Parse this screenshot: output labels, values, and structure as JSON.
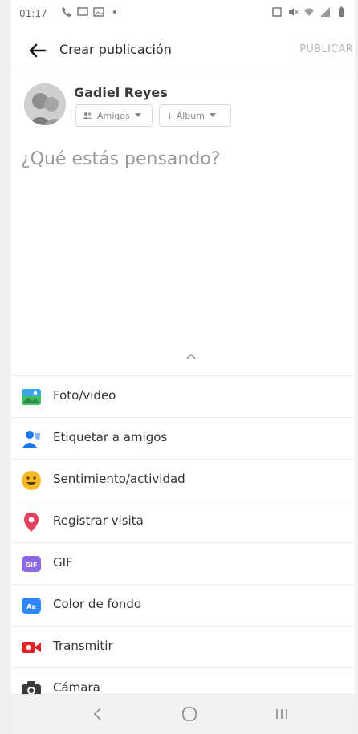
{
  "status_bar": {
    "time": "01:17"
  },
  "header": {
    "title": "Crear publicación",
    "publish_label": "PUBLICAR"
  },
  "author": {
    "name": "Gadiel Reyes",
    "audience_label": "Amigos",
    "album_label": "+ Álbum"
  },
  "composer": {
    "placeholder": "¿Qué estás pensando?"
  },
  "options": [
    {
      "label": "Foto/video",
      "icon": "photo-video-icon",
      "color": "#4CAF50"
    },
    {
      "label": "Etiquetar a amigos",
      "icon": "tag-friends-icon",
      "color": "#1877F2"
    },
    {
      "label": "Sentimiento/actividad",
      "icon": "feeling-icon",
      "color": "#F7B928"
    },
    {
      "label": "Registrar visita",
      "icon": "check-in-icon",
      "color": "#E4405F"
    },
    {
      "label": "GIF",
      "icon": "gif-icon",
      "color": "#8C68E3"
    },
    {
      "label": "Color de fondo",
      "icon": "background-color-icon",
      "color": "#2D88FF"
    },
    {
      "label": "Transmitir",
      "icon": "live-video-icon",
      "color": "#E02424"
    },
    {
      "label": "Cámara",
      "icon": "camera-icon",
      "color": "#3a3a3a"
    }
  ]
}
